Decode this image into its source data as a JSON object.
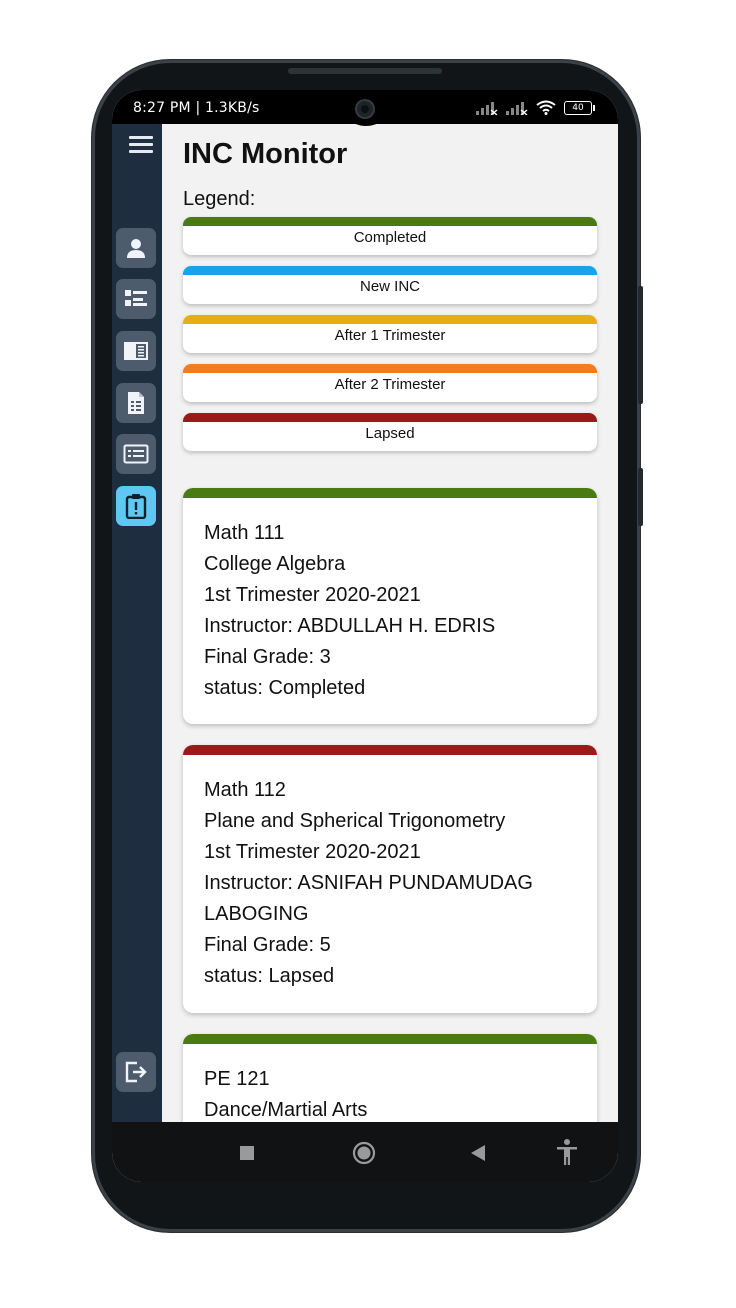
{
  "status_bar": {
    "time": "8:27 PM | 1.3KB/s",
    "battery": "40"
  },
  "app": {
    "title": "INC Monitor",
    "legend_label": "Legend:"
  },
  "sidebar": {
    "items": [
      {
        "icon": "user-icon"
      },
      {
        "icon": "list-icon"
      },
      {
        "icon": "book-icon"
      },
      {
        "icon": "document-icon"
      },
      {
        "icon": "id-card-icon"
      },
      {
        "icon": "clipboard-alert-icon",
        "active": true
      }
    ],
    "logout_icon": "logout-icon"
  },
  "legend": [
    {
      "label": "Completed",
      "color": "#4c7a12"
    },
    {
      "label": "New INC",
      "color": "#1aa2e6"
    },
    {
      "label": "After 1 Trimester",
      "color": "#e6ae14"
    },
    {
      "label": "After 2 Trimester",
      "color": "#f57c1c"
    },
    {
      "label": "Lapsed",
      "color": "#9a1a1a"
    }
  ],
  "courses": [
    {
      "color": "#4c7a12",
      "code": "Math 111",
      "name": "College Algebra",
      "term": "1st Trimester 2020-2021",
      "instructor": "Instructor: ABDULLAH H. EDRIS",
      "grade": "Final Grade: 3",
      "status": "status: Completed"
    },
    {
      "color": "#9a1a1a",
      "code": "Math 112",
      "name": "Plane and Spherical Trigonometry",
      "term": "1st Trimester 2020-2021",
      "instructor": "Instructor: ASNIFAH PUNDAMUDAG LABOGING",
      "grade": "Final Grade: 5",
      "status": "status: Lapsed"
    },
    {
      "color": "#4c7a12",
      "code": "PE 121",
      "name": "Dance/Martial Arts"
    }
  ]
}
